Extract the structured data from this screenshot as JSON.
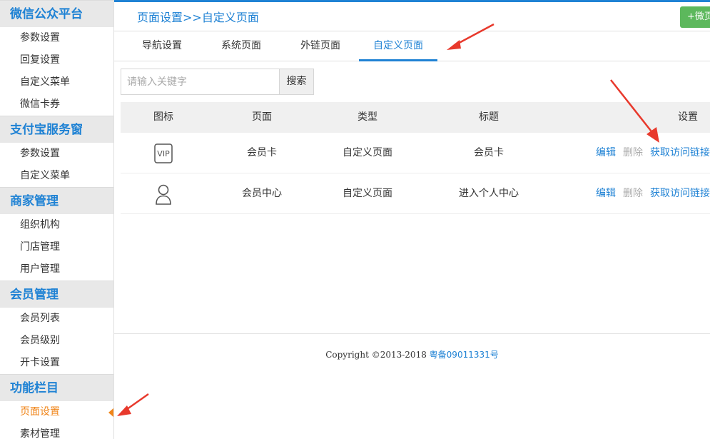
{
  "sidebar": {
    "groups": [
      {
        "title": "微信公众平台",
        "items": [
          "参数设置",
          "回复设置",
          "自定义菜单",
          "微信卡券"
        ]
      },
      {
        "title": "支付宝服务窗",
        "items": [
          "参数设置",
          "自定义菜单"
        ]
      },
      {
        "title": "商家管理",
        "items": [
          "组织机构",
          "门店管理",
          "用户管理"
        ]
      },
      {
        "title": "会员管理",
        "items": [
          "会员列表",
          "会员级别",
          "开卡设置"
        ]
      },
      {
        "title": "功能栏目",
        "items": [
          "页面设置",
          "素材管理"
        ]
      }
    ],
    "active_item": "页面设置"
  },
  "header": {
    "breadcrumb": "页面设置>>自定义页面",
    "action_button": "+微页"
  },
  "tabs": [
    {
      "label": "导航设置",
      "active": false
    },
    {
      "label": "系统页面",
      "active": false
    },
    {
      "label": "外链页面",
      "active": false
    },
    {
      "label": "自定义页面",
      "active": true
    }
  ],
  "search": {
    "placeholder": "请输入关键字",
    "button": "搜索"
  },
  "table": {
    "headers": [
      "图标",
      "页面",
      "类型",
      "标题",
      "设置"
    ],
    "rows": [
      {
        "icon": "vip-card-icon",
        "page": "会员卡",
        "type": "自定义页面",
        "title": "会员卡",
        "actions": [
          "编辑",
          "删除",
          "获取访问链接"
        ]
      },
      {
        "icon": "user-icon",
        "page": "会员中心",
        "type": "自定义页面",
        "title": "进入个人中心",
        "actions": [
          "编辑",
          "删除",
          "获取访问链接"
        ]
      }
    ]
  },
  "footer": {
    "copyright": "Copyright ©2013-2018",
    "icp": "粤备09011331号"
  },
  "colors": {
    "accent": "#1f82d4",
    "active_item": "#f08519",
    "annotation_arrow": "#e8392c",
    "action_button": "#5cb85c"
  }
}
